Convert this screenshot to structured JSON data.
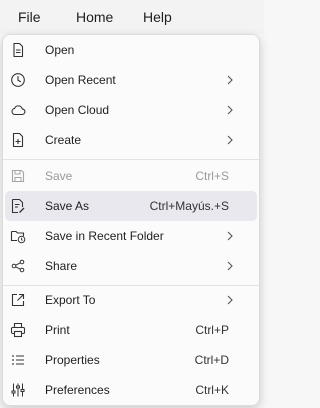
{
  "menubar": {
    "file": "File",
    "home": "Home",
    "help": "Help"
  },
  "menu": {
    "open": "Open",
    "open_recent": "Open Recent",
    "open_cloud": "Open Cloud",
    "create": "Create",
    "save": "Save",
    "save_shortcut": "Ctrl+S",
    "save_as": "Save As",
    "save_as_shortcut": "Ctrl+Mayús.+S",
    "save_recent_folder": "Save in Recent Folder",
    "share": "Share",
    "export_to": "Export To",
    "print": "Print",
    "print_shortcut": "Ctrl+P",
    "properties": "Properties",
    "properties_shortcut": "Ctrl+D",
    "preferences": "Preferences",
    "preferences_shortcut": "Ctrl+K"
  },
  "colors": {
    "highlight": "#e8e8ee",
    "disabled_text": "#9a9a9a"
  }
}
